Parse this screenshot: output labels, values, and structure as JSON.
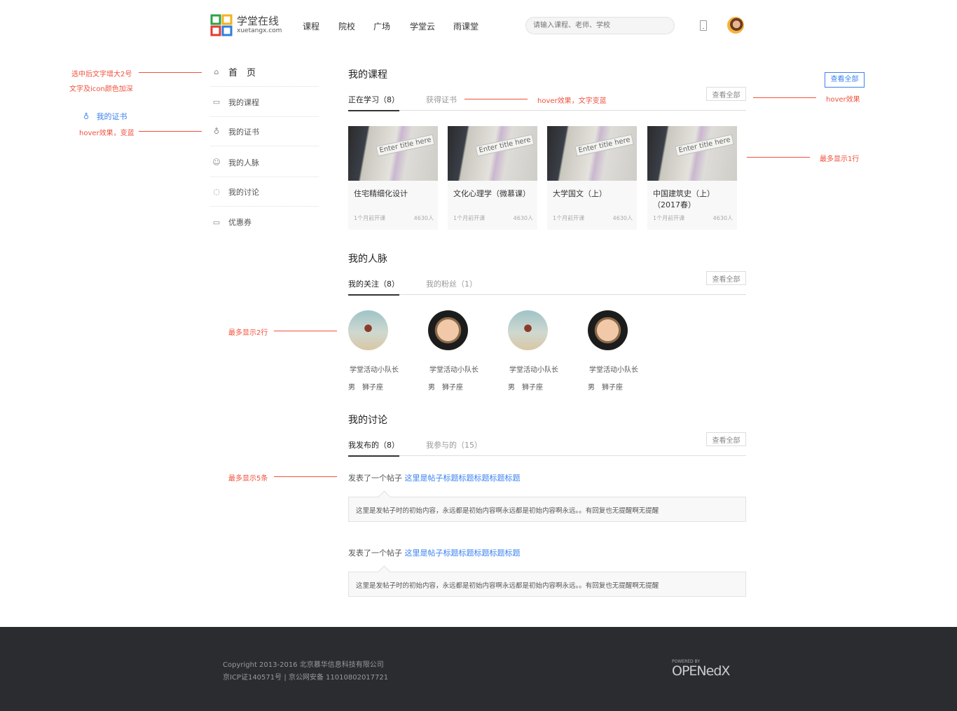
{
  "header": {
    "logo_cn": "学堂在线",
    "logo_en": "xuetangx.com",
    "nav": [
      "课程",
      "院校",
      "广场",
      "学堂云",
      "雨课堂"
    ],
    "search_placeholder": "请输入课程、老师、学校"
  },
  "sidebar": {
    "items": [
      {
        "label": "首　页",
        "icon": "home-icon"
      },
      {
        "label": "我的课程",
        "icon": "book-icon"
      },
      {
        "label": "我的证书",
        "icon": "medal-icon"
      },
      {
        "label": "我的人脉",
        "icon": "people-icon"
      },
      {
        "label": "我的讨论",
        "icon": "chat-icon"
      },
      {
        "label": "优惠券",
        "icon": "coupon-icon"
      }
    ]
  },
  "courses": {
    "title": "我的课程",
    "tabs": [
      "正在学习（8）",
      "获得证书"
    ],
    "view_all": "查看全部",
    "items": [
      {
        "name": "住宅精细化设计",
        "start": "1个月前开课",
        "count": "4630人",
        "thumb_text": "Enter title here"
      },
      {
        "name": "文化心理学（微慕课）",
        "start": "1个月前开课",
        "count": "4630人",
        "thumb_text": "Enter title here"
      },
      {
        "name": "大学国文（上）",
        "start": "1个月前开课",
        "count": "4630人",
        "thumb_text": "Enter title here"
      },
      {
        "name": "中国建筑史（上）（2017春）",
        "start": "1个月前开课",
        "count": "4630人",
        "thumb_text": "Enter title here"
      }
    ]
  },
  "network": {
    "title": "我的人脉",
    "tabs": [
      "我的关注（8）",
      "我的粉丝（1）"
    ],
    "view_all": "查看全部",
    "people": [
      {
        "name": "学堂活动小队长",
        "info": "男　狮子座"
      },
      {
        "name": "学堂活动小队长",
        "info": "男　狮子座"
      },
      {
        "name": "学堂活动小队长",
        "info": "男　狮子座"
      },
      {
        "name": "学堂活动小队长",
        "info": "男　狮子座"
      }
    ]
  },
  "discussion": {
    "title": "我的讨论",
    "tabs": [
      "我发布的（8）",
      "我参与的（15）"
    ],
    "view_all": "查看全部",
    "posts": [
      {
        "prefix": "发表了一个帖子",
        "link": "这里是帖子标题标题标题标题标题",
        "content": "这里是发帖子时的初始内容，永远都是初始内容啊永远都是初始内容啊永远。。有回复也无提醒啊无提醒"
      },
      {
        "prefix": "发表了一个帖子",
        "link": "这里是帖子标题标题标题标题标题",
        "content": "这里是发帖子时的初始内容，永远都是初始内容啊永远都是初始内容啊永远。。有回复也无提醒啊无提醒"
      }
    ]
  },
  "annotations": {
    "selected_1": "选中后文字增大2号",
    "selected_2": "文字及icon颜色加深",
    "hover_demo": "我的证书",
    "hover_blue": "hover效果，变蓝",
    "tab_hover": "hover效果，文字变蓝",
    "btn_demo": "查看全部",
    "btn_hover": "hover效果",
    "max1": "最多显示1行",
    "max2": "最多显示2行",
    "max5": "最多显示5条"
  },
  "footer": {
    "copyright": "Copyright 2013-2016 北京慕华信息科技有限公司",
    "icp": "京ICP证140571号 | 京公网安备 11010802017721",
    "powered": "POWERED BY",
    "brand": "OPENedX"
  },
  "colors": {
    "accent": "#3b82f0",
    "annotation": "#f0503c",
    "footer_bg": "#2a2c30"
  }
}
